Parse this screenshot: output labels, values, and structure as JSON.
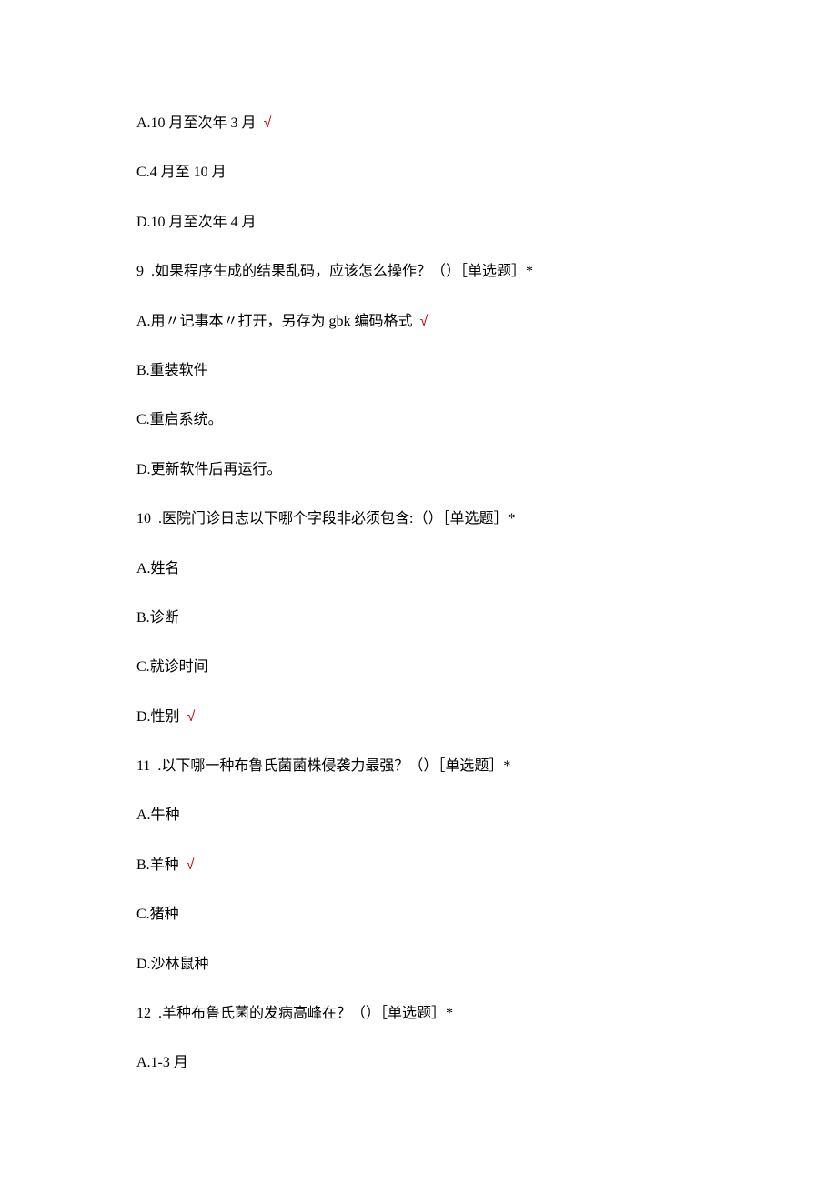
{
  "lines": [
    {
      "text": "A.10 月至次年 3 月 ",
      "check": true
    },
    {
      "text": "C.4 月至 10 月",
      "check": false
    },
    {
      "text": "D.10 月至次年 4 月",
      "check": false
    },
    {
      "text": "9  .如果程序生成的结果乱码，应该怎么操作？（）［单选题］*",
      "check": false
    },
    {
      "text": "A.用〃记事本〃打开，另存为 gbk 编码格式 ",
      "check": true
    },
    {
      "text": "B.重装软件",
      "check": false
    },
    {
      "text": "C.重启系统。",
      "check": false
    },
    {
      "text": "D.更新软件后再运行。",
      "check": false
    },
    {
      "text": "10  .医院门诊日志以下哪个字段非必须包含:（）［单选题］*",
      "check": false
    },
    {
      "text": "A.姓名",
      "check": false
    },
    {
      "text": "B.诊断",
      "check": false
    },
    {
      "text": "C.就诊时间",
      "check": false
    },
    {
      "text": "D.性别 ",
      "check": true
    },
    {
      "text": "11  .以下哪一种布鲁氏菌菌株侵袭力最强？（）［单选题］*",
      "check": false
    },
    {
      "text": "A.牛种",
      "check": false
    },
    {
      "text": "B.羊种 ",
      "check": true
    },
    {
      "text": "C.猪种",
      "check": false
    },
    {
      "text": "D.沙林鼠种",
      "check": false
    },
    {
      "text": "12  .羊种布鲁氏菌的发病高峰在？（）［单选题］*",
      "check": false
    },
    {
      "text": "A.1-3 月",
      "check": false
    }
  ],
  "check_mark": "√"
}
